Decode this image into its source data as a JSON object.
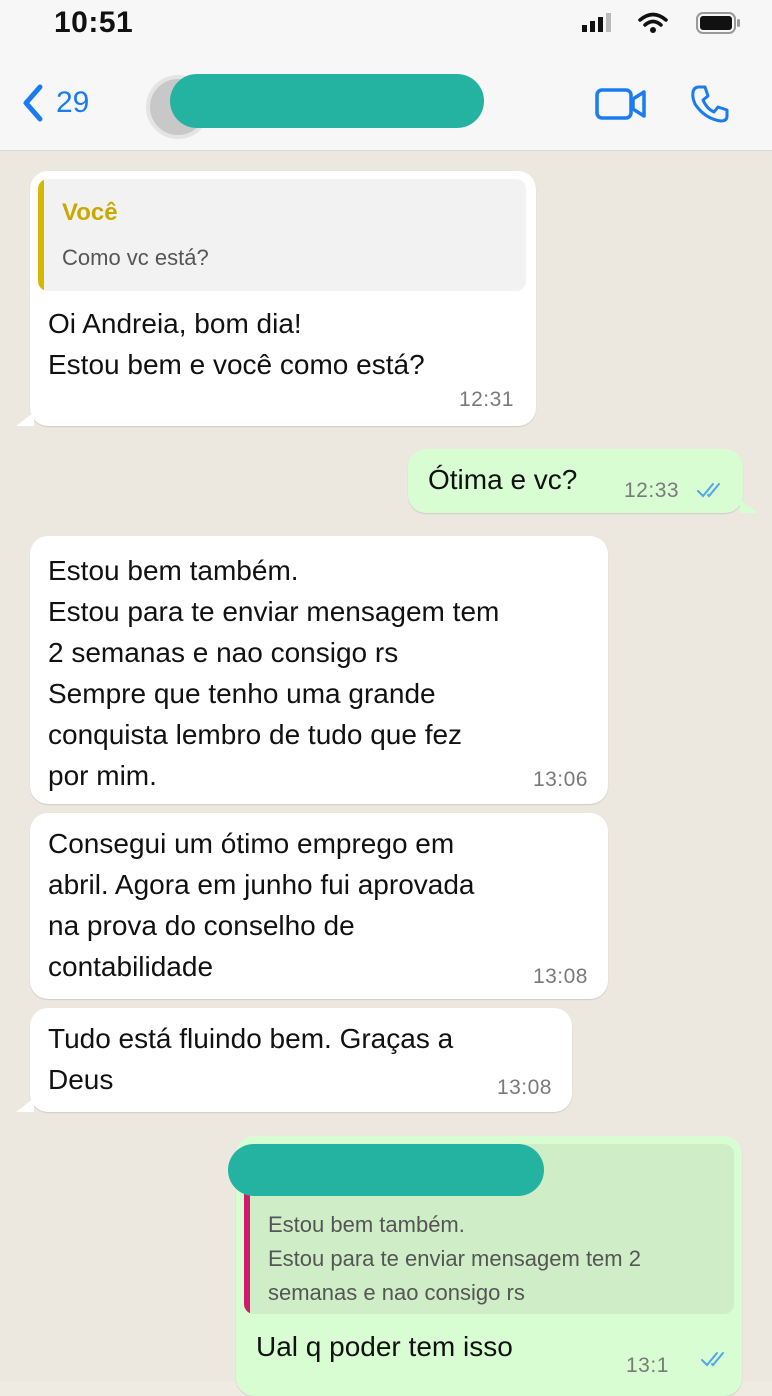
{
  "status_bar": {
    "time": "10:51"
  },
  "header": {
    "back_count": "29"
  },
  "colors": {
    "accent_blue": "#1a7cf0",
    "incoming_bubble": "#ffffff",
    "outgoing_bubble": "#d9fdd3",
    "quote_bar_you": "#d6b800",
    "quote_bar_contact": "#d21a6a",
    "redaction": "#25b3a1"
  },
  "messages": [
    {
      "direction": "incoming",
      "quote": {
        "author": "Você",
        "text": "Como vc está?"
      },
      "text": "Oi Andreia, bom dia!\nEstou bem e você como está?",
      "time": "12:31"
    },
    {
      "direction": "outgoing",
      "text": "Ótima e vc?",
      "time": "12:33",
      "read_receipt": "double-check-icon"
    },
    {
      "direction": "incoming",
      "text": "Estou bem também.\nEstou para te enviar mensagem tem\n2 semanas e nao consigo rs\nSempre que tenho uma grande\nconquista lembro de tudo que fez\npor mim.",
      "time": "13:06"
    },
    {
      "direction": "incoming",
      "text": "Consegui um ótimo emprego em\nabril. Agora em junho fui aprovada\nna prova do conselho de\ncontabilidade",
      "time": "13:08"
    },
    {
      "direction": "incoming",
      "text": "Tudo está fluindo bem. Graças a\nDeus",
      "time": "13:08"
    },
    {
      "direction": "outgoing",
      "quote": {
        "text": "Estou bem também.\nEstou para te enviar mensagem tem 2\nsemanas e nao consigo rs"
      },
      "text": "Ual q poder tem isso",
      "time": "13:1"
    }
  ]
}
